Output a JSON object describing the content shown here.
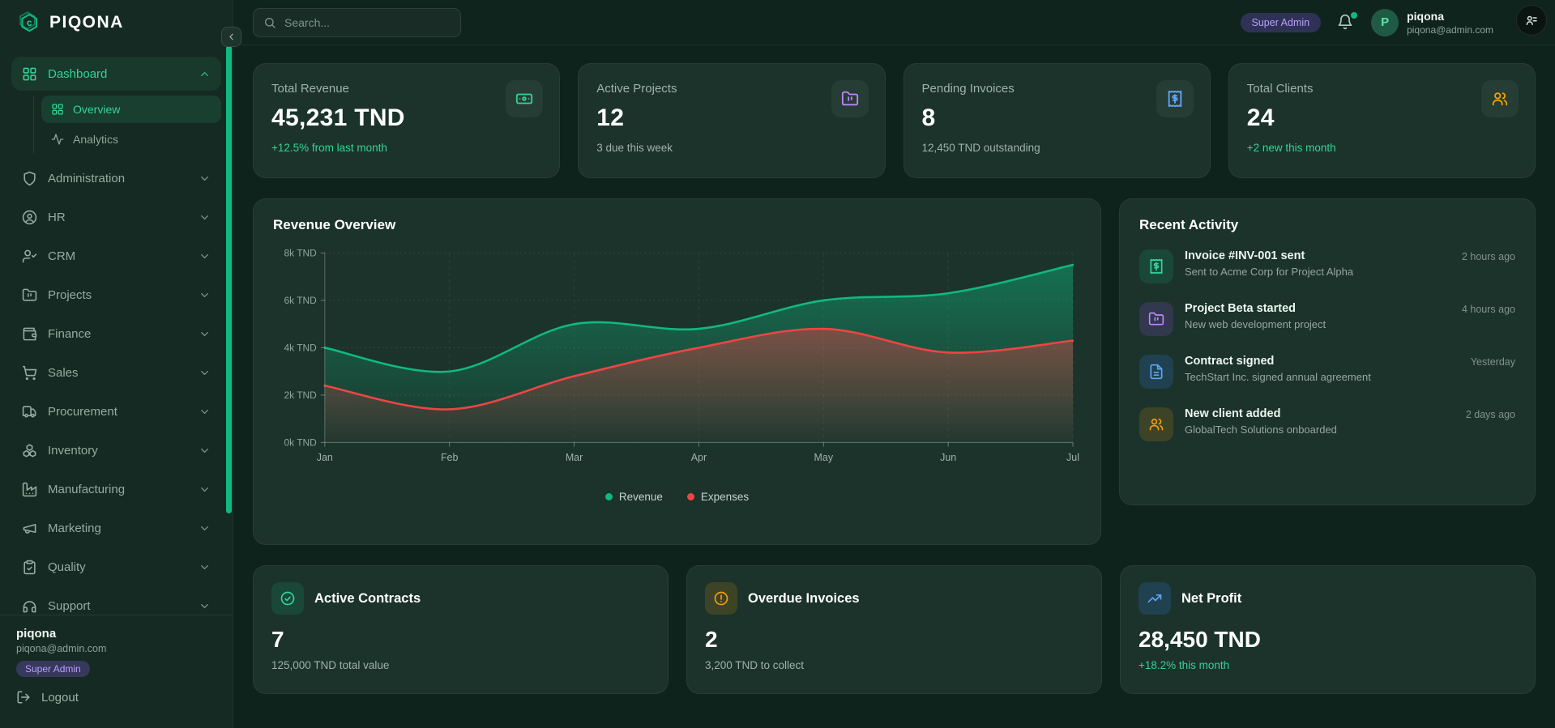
{
  "brand": {
    "name": "PIQONA"
  },
  "colors": {
    "accent": "#10b981",
    "positive": "#34d399",
    "revenue": "#10b981",
    "expenses": "#ef4444",
    "badge_purple": "#a78bfa"
  },
  "topbar": {
    "search_placeholder": "Search...",
    "role_badge": "Super Admin",
    "user_name": "piqona",
    "user_email": "piqona@admin.com",
    "avatar_initial": "P"
  },
  "sidebar": {
    "items": [
      {
        "label": "Dashboard",
        "icon": "grid-icon",
        "active": true,
        "expanded": true,
        "children": [
          {
            "label": "Overview",
            "icon": "grid-icon",
            "active": true
          },
          {
            "label": "Analytics",
            "icon": "activity-icon",
            "active": false
          }
        ]
      },
      {
        "label": "Administration",
        "icon": "shield-icon"
      },
      {
        "label": "HR",
        "icon": "user-circle-icon"
      },
      {
        "label": "CRM",
        "icon": "user-check-icon"
      },
      {
        "label": "Projects",
        "icon": "folder-icon"
      },
      {
        "label": "Finance",
        "icon": "wallet-icon"
      },
      {
        "label": "Sales",
        "icon": "cart-icon"
      },
      {
        "label": "Procurement",
        "icon": "truck-icon"
      },
      {
        "label": "Inventory",
        "icon": "boxes-icon"
      },
      {
        "label": "Manufacturing",
        "icon": "factory-icon"
      },
      {
        "label": "Marketing",
        "icon": "megaphone-icon"
      },
      {
        "label": "Quality",
        "icon": "clipboard-check-icon"
      },
      {
        "label": "Support",
        "icon": "headphones-icon"
      }
    ],
    "footer": {
      "name": "piqona",
      "email": "piqona@admin.com",
      "badge": "Super Admin",
      "logout_label": "Logout"
    }
  },
  "stats": [
    {
      "label": "Total Revenue",
      "value": "45,231 TND",
      "sub": "+12.5% from last month",
      "sub_type": "positive",
      "icon": "banknote-icon",
      "tint": "green"
    },
    {
      "label": "Active Projects",
      "value": "12",
      "sub": "3 due this week",
      "sub_type": "neutral",
      "icon": "folder-icon",
      "tint": "purple"
    },
    {
      "label": "Pending Invoices",
      "value": "8",
      "sub": "12,450 TND outstanding",
      "sub_type": "neutral",
      "icon": "receipt-icon",
      "tint": "blue"
    },
    {
      "label": "Total Clients",
      "value": "24",
      "sub": "+2 new this month",
      "sub_type": "positive",
      "icon": "users-icon",
      "tint": "orange"
    }
  ],
  "chart_card": {
    "title": "Revenue Overview"
  },
  "chart_data": {
    "type": "area",
    "title": "Revenue Overview",
    "x": [
      "Jan",
      "Feb",
      "Mar",
      "Apr",
      "May",
      "Jun",
      "Jul"
    ],
    "y_ticks": [
      "0k TND",
      "2k TND",
      "4k TND",
      "6k TND",
      "8k TND"
    ],
    "ylim": [
      0,
      8000
    ],
    "grid": true,
    "legend_position": "bottom",
    "series": [
      {
        "name": "Revenue",
        "color": "#10b981",
        "values": [
          4000,
          3000,
          5000,
          4800,
          6000,
          6300,
          7500
        ]
      },
      {
        "name": "Expenses",
        "color": "#ef4444",
        "values": [
          2400,
          1400,
          2800,
          4000,
          4800,
          3800,
          4300
        ]
      }
    ]
  },
  "activity": {
    "title": "Recent Activity",
    "items": [
      {
        "title": "Invoice #INV-001 sent",
        "sub": "Sent to Acme Corp for Project Alpha",
        "time": "2 hours ago",
        "icon": "receipt-icon",
        "tint": "green"
      },
      {
        "title": "Project Beta started",
        "sub": "New web development project",
        "time": "4 hours ago",
        "icon": "folder-icon",
        "tint": "purple"
      },
      {
        "title": "Contract signed",
        "sub": "TechStart Inc. signed annual agreement",
        "time": "Yesterday",
        "icon": "file-text-icon",
        "tint": "blue"
      },
      {
        "title": "New client added",
        "sub": "GlobalTech Solutions onboarded",
        "time": "2 days ago",
        "icon": "users-icon",
        "tint": "orange"
      }
    ]
  },
  "bottom_cards": [
    {
      "title": "Active Contracts",
      "value": "7",
      "sub": "125,000 TND total value",
      "sub_type": "neutral",
      "icon": "circle-check-icon",
      "tint": "green"
    },
    {
      "title": "Overdue Invoices",
      "value": "2",
      "sub": "3,200 TND to collect",
      "sub_type": "neutral",
      "icon": "alert-circle-icon",
      "tint": "orange"
    },
    {
      "title": "Net Profit",
      "value": "28,450 TND",
      "sub": "+18.2% this month",
      "sub_type": "positive",
      "icon": "trending-up-icon",
      "tint": "blue"
    }
  ]
}
